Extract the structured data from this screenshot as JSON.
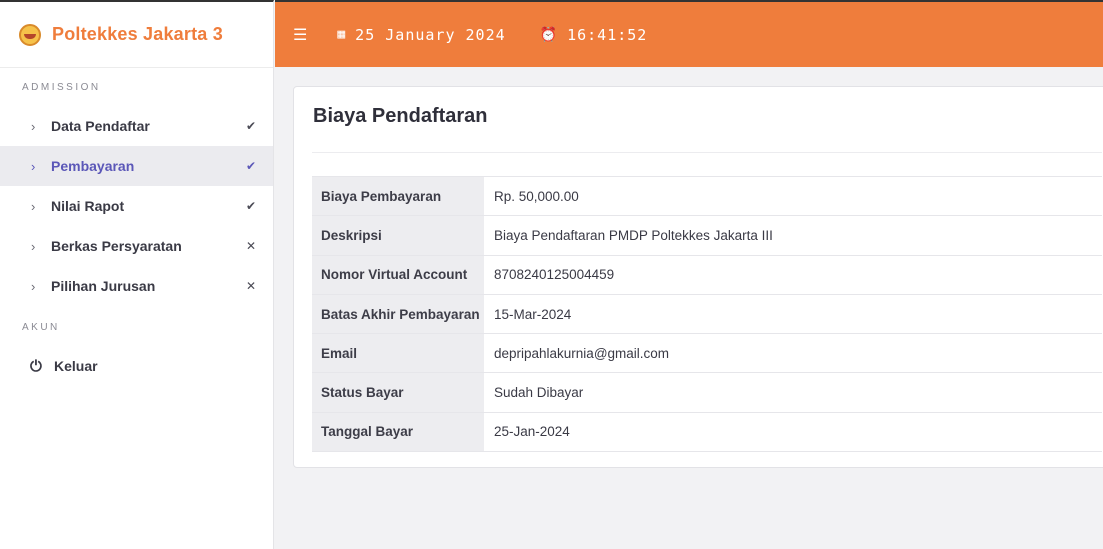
{
  "sidebar": {
    "brand": "Poltekkes Jakarta 3",
    "section_admission": "ADMISSION",
    "section_akun": "AKUN",
    "items": [
      {
        "label": "Data Pendaftar",
        "mark": "✔"
      },
      {
        "label": "Pembayaran",
        "mark": "✔"
      },
      {
        "label": "Nilai Rapot",
        "mark": "✔"
      },
      {
        "label": "Berkas Persyaratan",
        "mark": "✕"
      },
      {
        "label": "Pilihan Jurusan",
        "mark": "✕"
      }
    ],
    "logout_label": "Keluar"
  },
  "topbar": {
    "date": "25 January 2024",
    "time": "16:41:52"
  },
  "card": {
    "title": "Biaya Pendaftaran",
    "rows": [
      {
        "key": "Biaya Pembayaran",
        "value": "Rp. 50,000.00"
      },
      {
        "key": "Deskripsi",
        "value": "Biaya Pendaftaran PMDP Poltekkes Jakarta III"
      },
      {
        "key": "Nomor Virtual Account",
        "value": "8708240125004459"
      },
      {
        "key": "Batas Akhir Pembayaran",
        "value": "15-Mar-2024"
      },
      {
        "key": "Email",
        "value": "depripahlakurnia@gmail.com"
      },
      {
        "key": "Status Bayar",
        "value": "Sudah Dibayar"
      },
      {
        "key": "Tanggal Bayar",
        "value": "25-Jan-2024"
      }
    ]
  },
  "colors": {
    "accent": "#ef7d3c",
    "active_text": "#5b57b8"
  }
}
